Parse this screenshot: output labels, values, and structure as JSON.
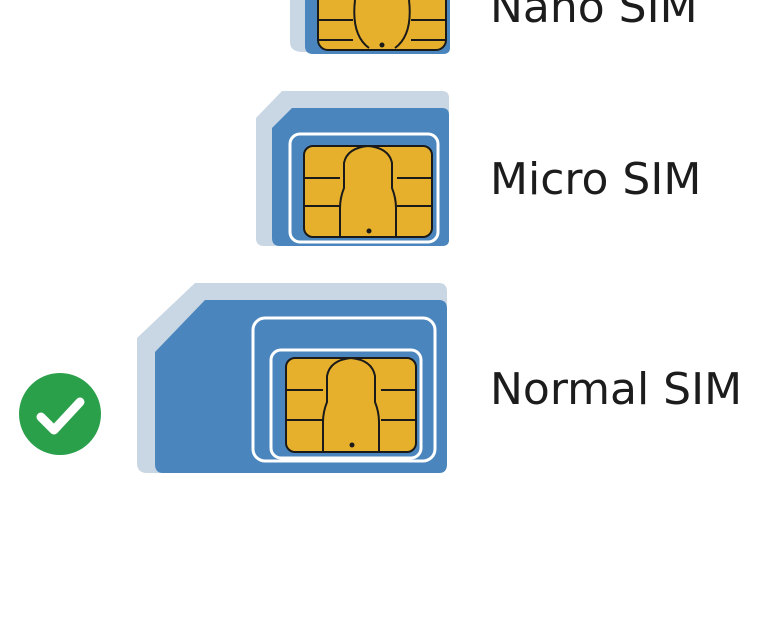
{
  "sim_options": [
    {
      "id": "nano",
      "label": "Nano SIM",
      "selected": false
    },
    {
      "id": "micro",
      "label": "Micro SIM",
      "selected": false
    },
    {
      "id": "normal",
      "label": "Normal SIM",
      "selected": true
    }
  ],
  "colors": {
    "card_blue": "#4a86bd",
    "card_shadow": "#c9d6e3",
    "chip_gold": "#e6b02c",
    "check_green": "#2aa04a"
  },
  "icons": {
    "check": "check-circle-icon"
  }
}
